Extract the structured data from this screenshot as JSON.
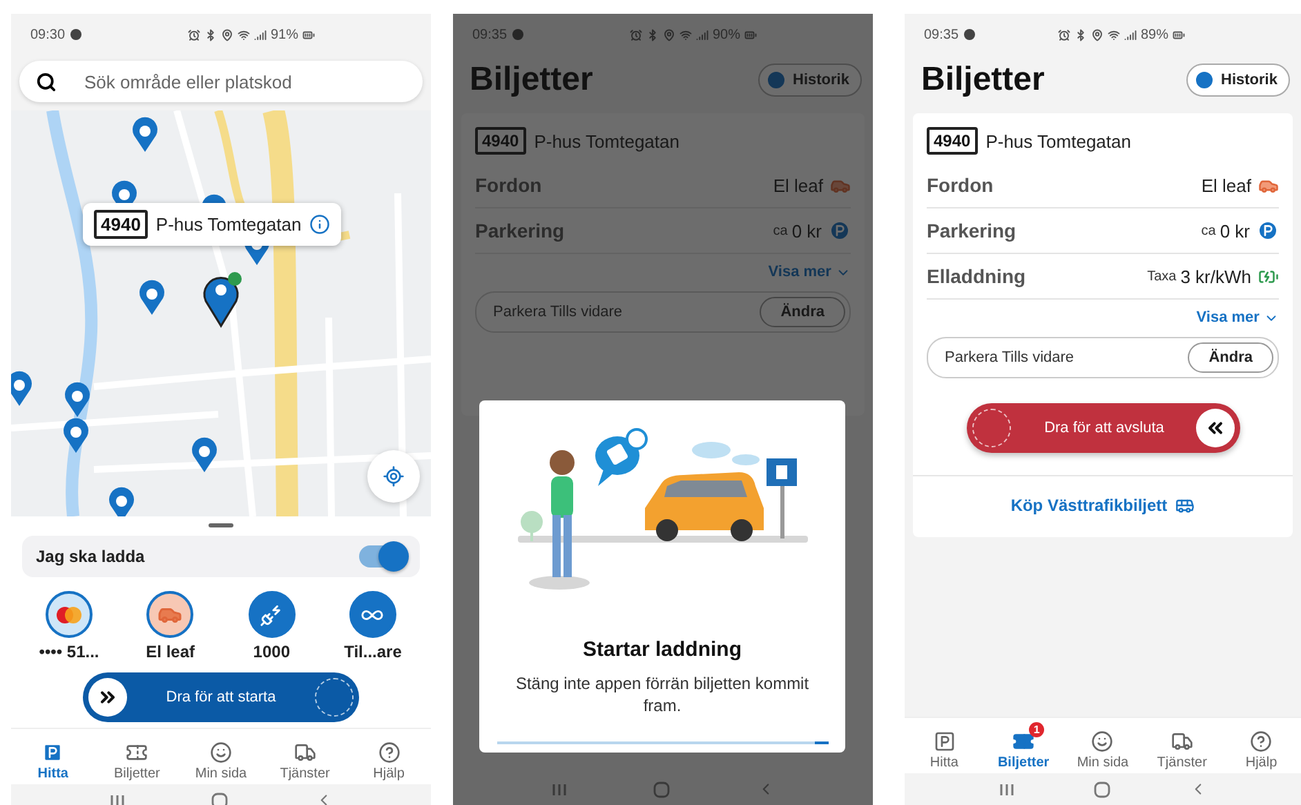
{
  "screens": [
    {
      "kind": "map",
      "status_bar": {
        "time": "09:30",
        "battery": "91%"
      },
      "search": {
        "placeholder": "Sök område eller platskod"
      },
      "map_popup": {
        "code": "4940",
        "name": "P-hus Tomtegatan"
      },
      "charge_toggle": {
        "label": "Jag ska ladda",
        "on": true
      },
      "options": [
        {
          "kind": "card",
          "label": "•••• 51..."
        },
        {
          "kind": "car",
          "label": "El leaf"
        },
        {
          "kind": "charger",
          "label": "1000"
        },
        {
          "kind": "duration",
          "label": "Til...are"
        }
      ],
      "start_slider": {
        "label": "Dra för att starta",
        "level": 0
      },
      "nav": [
        {
          "kind": "parking",
          "label": "Hitta",
          "selected": true
        },
        {
          "kind": "tickets",
          "label": "Biljetter",
          "selected": false
        },
        {
          "kind": "profile",
          "label": "Min sida",
          "selected": false
        },
        {
          "kind": "services",
          "label": "Tjänster",
          "selected": false
        },
        {
          "kind": "help",
          "label": "Hjälp",
          "selected": false
        }
      ]
    },
    {
      "kind": "tickets",
      "status_bar": {
        "time": "09:35",
        "battery": "90%"
      },
      "title": "Biljetter",
      "history_button": "Historik",
      "ticket": {
        "code": "4940",
        "name": "P-hus Tomtegatan",
        "rows": [
          {
            "kind": "car",
            "label": "Fordon",
            "value": "El leaf"
          },
          {
            "kind": "parking",
            "label": "Parkering",
            "prefix": "ca",
            "value": "0 kr"
          }
        ],
        "more_link": "Visa mer",
        "duration": {
          "label": "Parkera Tills vidare",
          "button": "Ändra"
        }
      },
      "dialog": {
        "title": "Startar laddning",
        "message": "Stäng inte appen förrän biljetten kommit fram.",
        "progress": {
          "level": 0.04
        }
      }
    },
    {
      "kind": "tickets",
      "status_bar": {
        "time": "09:35",
        "battery": "89%"
      },
      "title": "Biljetter",
      "history_button": "Historik",
      "ticket": {
        "code": "4940",
        "name": "P-hus Tomtegatan",
        "rows": [
          {
            "kind": "car",
            "label": "Fordon",
            "value": "El leaf"
          },
          {
            "kind": "parking",
            "label": "Parkering",
            "prefix": "ca",
            "value": "0 kr"
          },
          {
            "kind": "charging",
            "label": "Elladdning",
            "prefix": "Taxa",
            "value": "3 kr/kWh"
          }
        ],
        "more_link": "Visa mer",
        "duration": {
          "label": "Parkera Tills vidare",
          "button": "Ändra"
        },
        "end_slider": {
          "label": "Dra för att avsluta",
          "level": 1
        },
        "buy_link": "Köp Västtrafikbiljett"
      },
      "nav": [
        {
          "kind": "parking",
          "label": "Hitta",
          "selected": false
        },
        {
          "kind": "tickets",
          "label": "Biljetter",
          "selected": true,
          "badge": "1"
        },
        {
          "kind": "profile",
          "label": "Min sida",
          "selected": false
        },
        {
          "kind": "services",
          "label": "Tjänster",
          "selected": false
        },
        {
          "kind": "help",
          "label": "Hjälp",
          "selected": false
        }
      ]
    }
  ]
}
